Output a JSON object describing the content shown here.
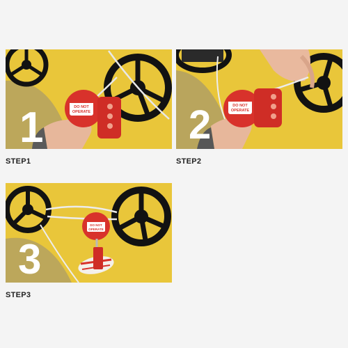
{
  "steps": [
    {
      "number": "1",
      "label": "STEP1"
    },
    {
      "number": "2",
      "label": "STEP2"
    },
    {
      "number": "3",
      "label": "STEP3"
    }
  ],
  "device": {
    "sign_text_line1": "DO NOT",
    "sign_text_line2": "OPERATE"
  },
  "colors": {
    "background": "#f4f4f4",
    "panel_yellow": "#e9c63a",
    "lockout_red": "#d8322b",
    "handwheel": "#121212",
    "numeral": "#ffffff"
  }
}
